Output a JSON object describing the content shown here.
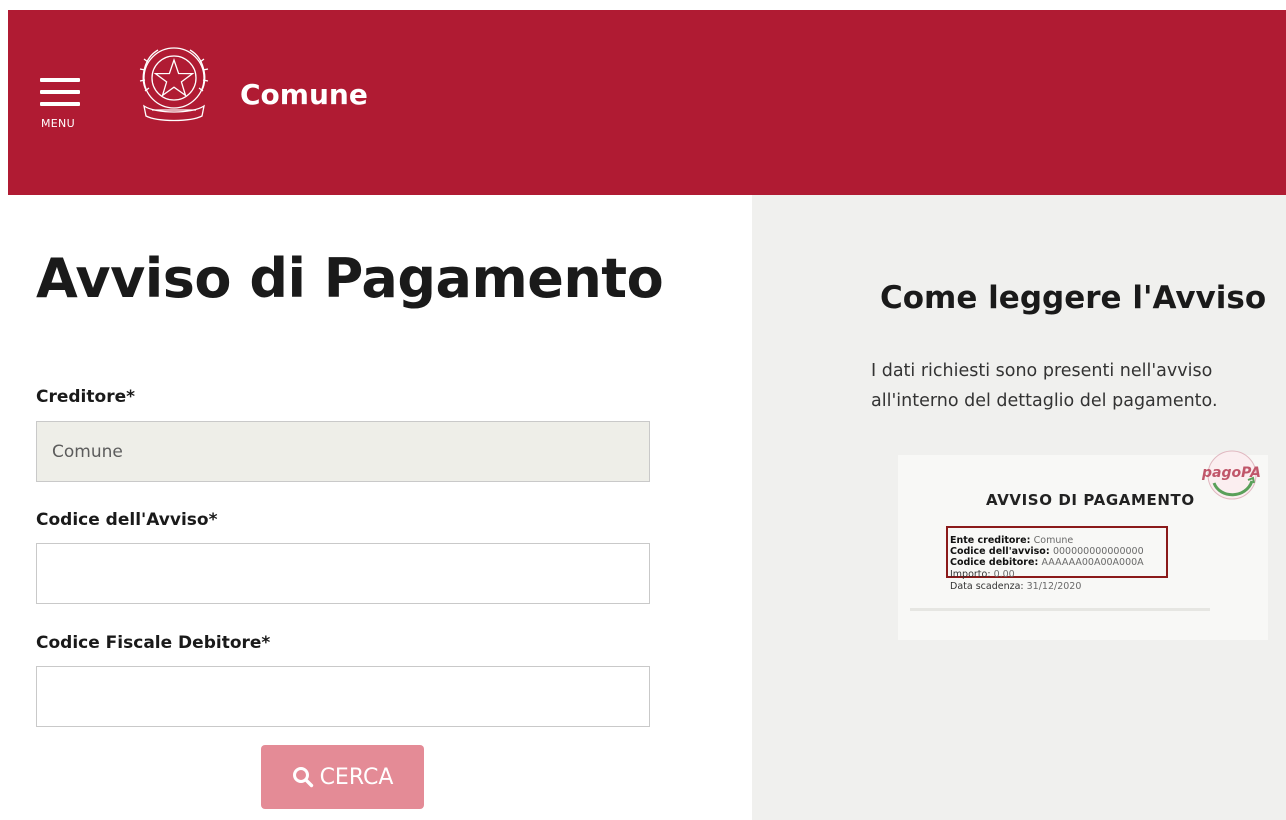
{
  "header": {
    "menu_label": "MENU",
    "brand": "Comune",
    "background": "#b01b33"
  },
  "main": {
    "title": "Avviso di Pagamento",
    "fields": [
      {
        "label": "Creditore*",
        "value": "Comune",
        "placeholder": "",
        "readonly": true
      },
      {
        "label": "Codice dell'Avviso*",
        "value": "",
        "placeholder": ""
      },
      {
        "label": "Codice Fiscale Debitore*",
        "value": "",
        "placeholder": ""
      }
    ],
    "search_button": {
      "label": "CERCA",
      "icon": "search-icon",
      "color": "#e48b96"
    }
  },
  "side": {
    "title": "Come leggere l'Avviso",
    "text_line1": "I dati richiesti sono presenti nell'avviso",
    "text_line2": "all'interno del dettaglio del pagamento.",
    "notice": {
      "logo_text": "pagoPA",
      "title": "AVVISO DI PAGAMENTO",
      "lines": [
        {
          "label": "Ente creditore",
          "value": "Comune"
        },
        {
          "label": "Codice dell'avviso",
          "value": "000000000000000"
        },
        {
          "label": "Codice debitore",
          "value": "AAAAAA00A00A000A"
        },
        {
          "label": "Importo",
          "value": "0.00"
        },
        {
          "label": "Data scadenza",
          "value": "31/12/2020"
        }
      ]
    }
  }
}
